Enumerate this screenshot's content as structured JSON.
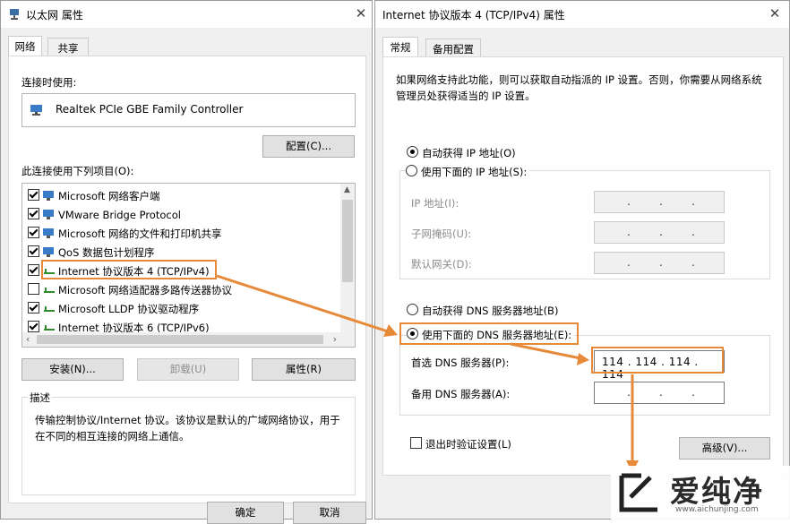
{
  "left_window": {
    "title": "以太网 属性",
    "tabs": [
      {
        "label": "网络"
      },
      {
        "label": "共享"
      }
    ],
    "connect_using_label": "连接时使用:",
    "adapter_name": "Realtek PCIe GBE Family Controller",
    "configure_button": "配置(C)...",
    "items_label": "此连接使用下列项目(O):",
    "items": [
      {
        "label": "Microsoft 网络客户端",
        "checked": true
      },
      {
        "label": "VMware Bridge Protocol",
        "checked": true
      },
      {
        "label": "Microsoft 网络的文件和打印机共享",
        "checked": true
      },
      {
        "label": "QoS 数据包计划程序",
        "checked": true
      },
      {
        "label": "Internet 协议版本 4 (TCP/IPv4)",
        "checked": true
      },
      {
        "label": "Microsoft 网络适配器多路传送器协议",
        "checked": false
      },
      {
        "label": "Microsoft LLDP 协议驱动程序",
        "checked": true
      },
      {
        "label": "Internet 协议版本 6 (TCP/IPv6)",
        "checked": true
      }
    ],
    "install_button": "安装(N)...",
    "uninstall_button": "卸载(U)",
    "properties_button": "属性(R)",
    "description_title": "描述",
    "description_text": "传输控制协议/Internet 协议。该协议是默认的广域网络协议，用于在不同的相互连接的网络上通信。",
    "ok_button": "确定",
    "cancel_button": "取消"
  },
  "right_window": {
    "title": "Internet 协议版本 4 (TCP/IPv4) 属性",
    "tabs": [
      {
        "label": "常规"
      },
      {
        "label": "备用配置"
      }
    ],
    "intro_text": "如果网络支持此功能，则可以获取自动指派的 IP 设置。否则，你需要从网络系统管理员处获得适当的 IP 设置。",
    "auto_ip_label": "自动获得 IP 地址(O)",
    "manual_ip_label": "使用下面的 IP 地址(S):",
    "ip_address_label": "IP 地址(I):",
    "subnet_mask_label": "子网掩码(U):",
    "default_gateway_label": "默认网关(D):",
    "auto_dns_label": "自动获得 DNS 服务器地址(B)",
    "manual_dns_label": "使用下面的 DNS 服务器地址(E):",
    "preferred_dns_label": "首选 DNS 服务器(P):",
    "preferred_dns_value": "114 . 114 . 114 . 114",
    "alternate_dns_label": "备用 DNS 服务器(A):",
    "validate_label": "退出时验证设置(L)",
    "advanced_button": "高级(V)..."
  },
  "watermark": {
    "brand": "爱纯净",
    "url": "www.aichunjing.com"
  },
  "colors": {
    "highlight": "#e68a3a",
    "tab_active": "#ffffff",
    "window_bg": "#f0f0f0",
    "watermark": "#2b2b2b"
  }
}
